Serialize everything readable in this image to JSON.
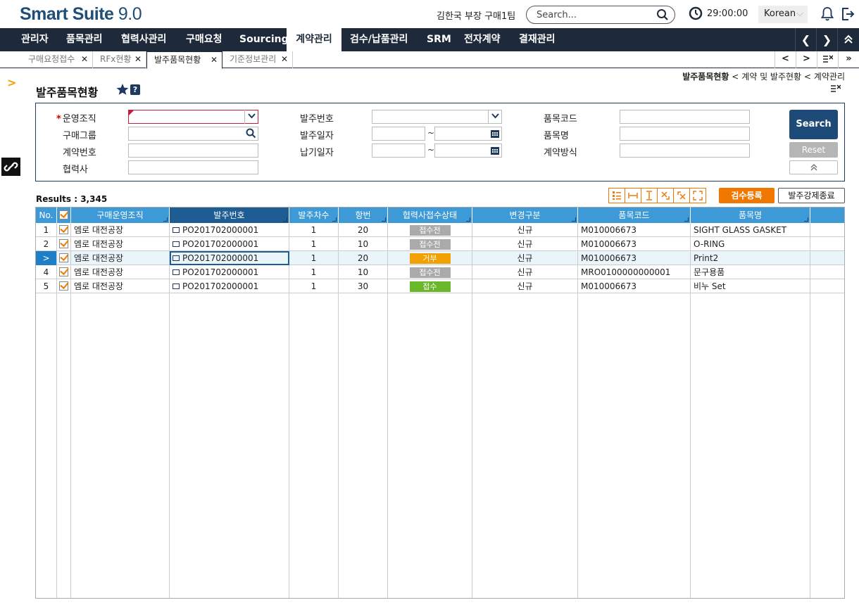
{
  "header": {
    "brand": "Smart Suite",
    "version": "9.0",
    "user": "김한국 부장 구매1팀",
    "search_placeholder": "Search...",
    "timer": "29:00:00",
    "language": "Korean"
  },
  "mainnav": {
    "items": [
      "관리자",
      "품목관리",
      "협력사관리",
      "구매요청",
      "Sourcing",
      "계약관리",
      "검수/납품관리",
      "SRM",
      "전자계약",
      "결재관리"
    ],
    "active": "계약관리"
  },
  "tabs": [
    {
      "label": "구매요청접수"
    },
    {
      "label": "RFx현황"
    },
    {
      "label": "발주품목현황"
    },
    {
      "label": "기준정보관리"
    }
  ],
  "breadcrumb": {
    "current": "발주품목현황",
    "parent": "계약 및 발주현황",
    "root": "계약관리",
    "sep": "<"
  },
  "page_title": "발주품목현황",
  "search_form": {
    "labels": {
      "org": "운영조직",
      "purchase_group": "구매그룹",
      "contract_no": "계약번호",
      "vendor": "협력사",
      "po_no": "발주번호",
      "po_date": "발주일자",
      "delivery_date": "납기일자",
      "item_code": "품목코드",
      "item_name": "품목명",
      "contract_method": "계약방식"
    },
    "required_mark": "*",
    "tilde": "~",
    "search_button": "Search",
    "reset_button": "Reset"
  },
  "results": {
    "label": "Results : 3,345"
  },
  "actions": {
    "register": "검수등록",
    "force_close": "발주강제종료"
  },
  "grid": {
    "columns": [
      "No.",
      "",
      "구매운영조직",
      "발주번호",
      "발주차수",
      "항번",
      "협력사접수상태",
      "변경구분",
      "품목코드",
      "품목명"
    ],
    "rows": [
      {
        "no": "1",
        "org": "엠로 대전공장",
        "po": "PO201702000001",
        "seq": "1",
        "line": "20",
        "status": "접수전",
        "status_color": "gray",
        "change": "신규",
        "code": "M010006673",
        "name": "SIGHT GLASS GASKET"
      },
      {
        "no": "2",
        "org": "엠로 대전공장",
        "po": "PO201702000001",
        "seq": "1",
        "line": "10",
        "status": "접수전",
        "status_color": "gray",
        "change": "신규",
        "code": "M010006673",
        "name": "O-RING"
      },
      {
        "no": "3",
        "org": "엠로 대전공장",
        "po": "PO201702000001",
        "seq": "1",
        "line": "20",
        "status": "거부",
        "status_color": "orange",
        "change": "신규",
        "code": "M010006673",
        "name": "Print2"
      },
      {
        "no": "4",
        "org": "엠로 대전공장",
        "po": "PO201702000001",
        "seq": "1",
        "line": "10",
        "status": "접수전",
        "status_color": "gray",
        "change": "신규",
        "code": "MRO0100000000001",
        "name": "문구용품"
      },
      {
        "no": "5",
        "org": "엠로 대전공장",
        "po": "PO201702000001",
        "seq": "1",
        "line": "30",
        "status": "접수",
        "status_color": "green",
        "change": "신규",
        "code": "M010006673",
        "name": "비누 Set"
      }
    ],
    "selected_row_marker": ">"
  }
}
